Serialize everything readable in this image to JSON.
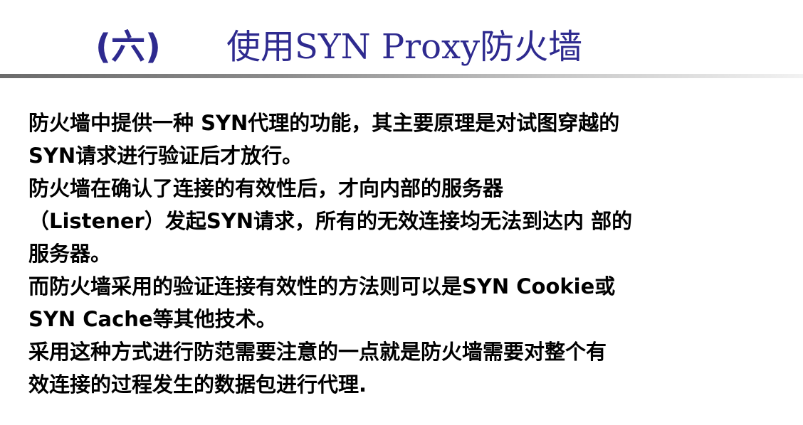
{
  "slide": {
    "title_index": "(六)",
    "title_text": "使用SYN Proxy防火墙",
    "lines": [
      "防火墙中提供一种 SYN代理的功能，其主要原理是对试图穿越的",
      "SYN请求进行验证后才放行。",
      "防火墙在确认了连接的有效性后，才向内部的服务器",
      "（Listener）发起SYN请求，所有的无效连接均无法到达内 部的",
      "服务器。",
      "而防火墙采用的验证连接有效性的方法则可以是SYN Cookie或",
      "SYN Cache等其他技术。",
      "采用这种方式进行防范需要注意的一点就是防火墙需要对整个有",
      "效连接的过程发生的数据包进行代理."
    ]
  },
  "colors": {
    "title": "#2e2a8f",
    "body_text": "#000000",
    "background": "#ffffff"
  }
}
